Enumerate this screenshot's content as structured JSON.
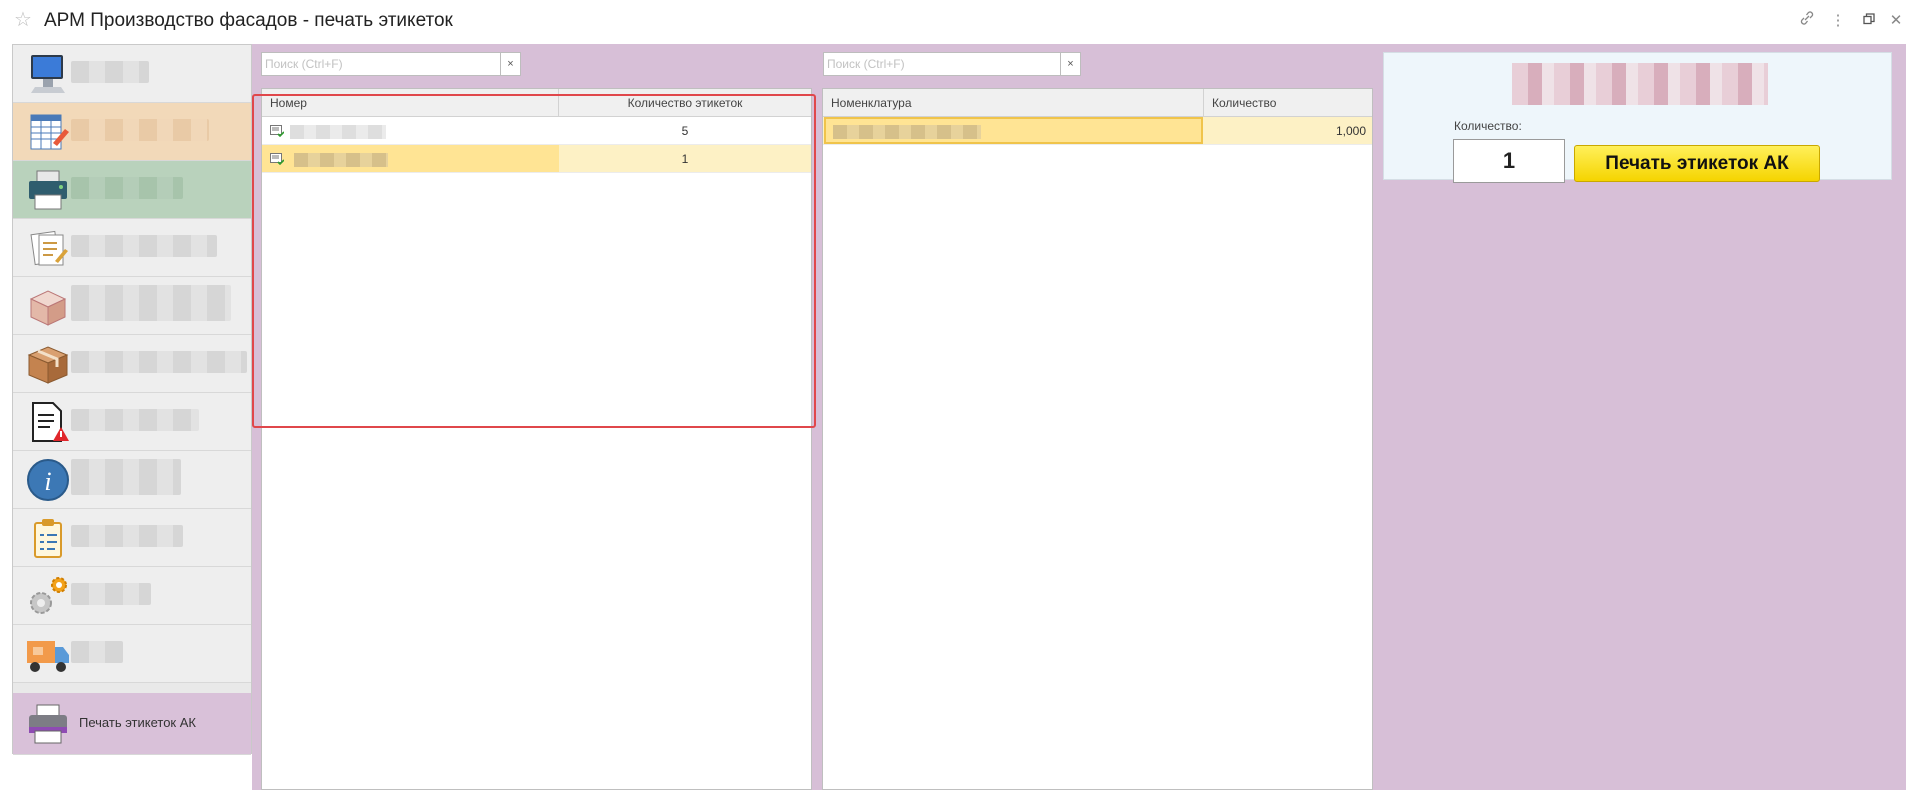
{
  "window": {
    "title": "АРМ Производство фасадов - печать этикеток"
  },
  "sidebar": {
    "items": [
      {
        "icon": "computer-icon"
      },
      {
        "icon": "spreadsheet-edit-icon"
      },
      {
        "icon": "printer-icon"
      },
      {
        "icon": "documents-edit-icon"
      },
      {
        "icon": "open-box-icon"
      },
      {
        "icon": "closed-box-icon"
      },
      {
        "icon": "document-warning-icon"
      },
      {
        "icon": "info-icon"
      },
      {
        "icon": "clipboard-icon"
      },
      {
        "icon": "gears-icon"
      },
      {
        "icon": "delivery-truck-icon"
      },
      {
        "icon": "label-printer-icon",
        "label": "Печать этикеток АК"
      }
    ]
  },
  "left_panel": {
    "search": {
      "placeholder": "Поиск (Ctrl+F)",
      "clear": "×"
    },
    "columns": [
      "Номер",
      "Количество этикеток"
    ],
    "rows": [
      {
        "count": "5"
      },
      {
        "count": "1"
      }
    ]
  },
  "middle_panel": {
    "search": {
      "placeholder": "Поиск (Ctrl+F)",
      "clear": "×"
    },
    "columns": [
      "Номенклатура",
      "Количество"
    ],
    "rows": [
      {
        "quantity": "1,000"
      }
    ]
  },
  "right_panel": {
    "quantity_label": "Количество:",
    "quantity_value": "1",
    "print_button": "Печать этикеток АК"
  },
  "colors": {
    "background": "#d7bfd7",
    "selection": "#ffe494",
    "highlight_frame": "#e0474b",
    "button": "#f5d400"
  }
}
